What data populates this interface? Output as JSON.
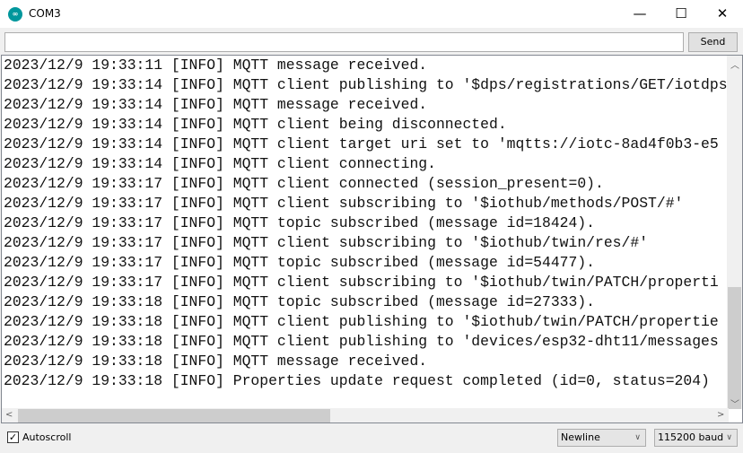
{
  "window": {
    "title": "COM3",
    "minimize": "—",
    "maximize": "☐",
    "close": "✕"
  },
  "input": {
    "value": "",
    "send_label": "Send"
  },
  "log": [
    "2023/12/9 19:33:11 [INFO] MQTT message received.",
    "2023/12/9 19:33:14 [INFO] MQTT client publishing to '$dps/registrations/GET/iotdps",
    "2023/12/9 19:33:14 [INFO] MQTT message received.",
    "2023/12/9 19:33:14 [INFO] MQTT client being disconnected.",
    "2023/12/9 19:33:14 [INFO] MQTT client target uri set to 'mqtts://iotc-8ad4f0b3-e5",
    "2023/12/9 19:33:14 [INFO] MQTT client connecting.",
    "2023/12/9 19:33:17 [INFO] MQTT client connected (session_present=0).",
    "2023/12/9 19:33:17 [INFO] MQTT client subscribing to '$iothub/methods/POST/#'",
    "2023/12/9 19:33:17 [INFO] MQTT topic subscribed (message id=18424).",
    "2023/12/9 19:33:17 [INFO] MQTT client subscribing to '$iothub/twin/res/#'",
    "2023/12/9 19:33:17 [INFO] MQTT topic subscribed (message id=54477).",
    "2023/12/9 19:33:17 [INFO] MQTT client subscribing to '$iothub/twin/PATCH/properti",
    "2023/12/9 19:33:18 [INFO] MQTT topic subscribed (message id=27333).",
    "2023/12/9 19:33:18 [INFO] MQTT client publishing to '$iothub/twin/PATCH/propertie",
    "2023/12/9 19:33:18 [INFO] MQTT client publishing to 'devices/esp32-dht11/messages",
    "2023/12/9 19:33:18 [INFO] MQTT message received.",
    "2023/12/9 19:33:18 [INFO] Properties update request completed (id=0, status=204)"
  ],
  "footer": {
    "autoscroll_label": "Autoscroll",
    "autoscroll_checked": true,
    "line_ending": "Newline",
    "baud": "115200 baud"
  },
  "colors": {
    "logo": "#00979c"
  }
}
